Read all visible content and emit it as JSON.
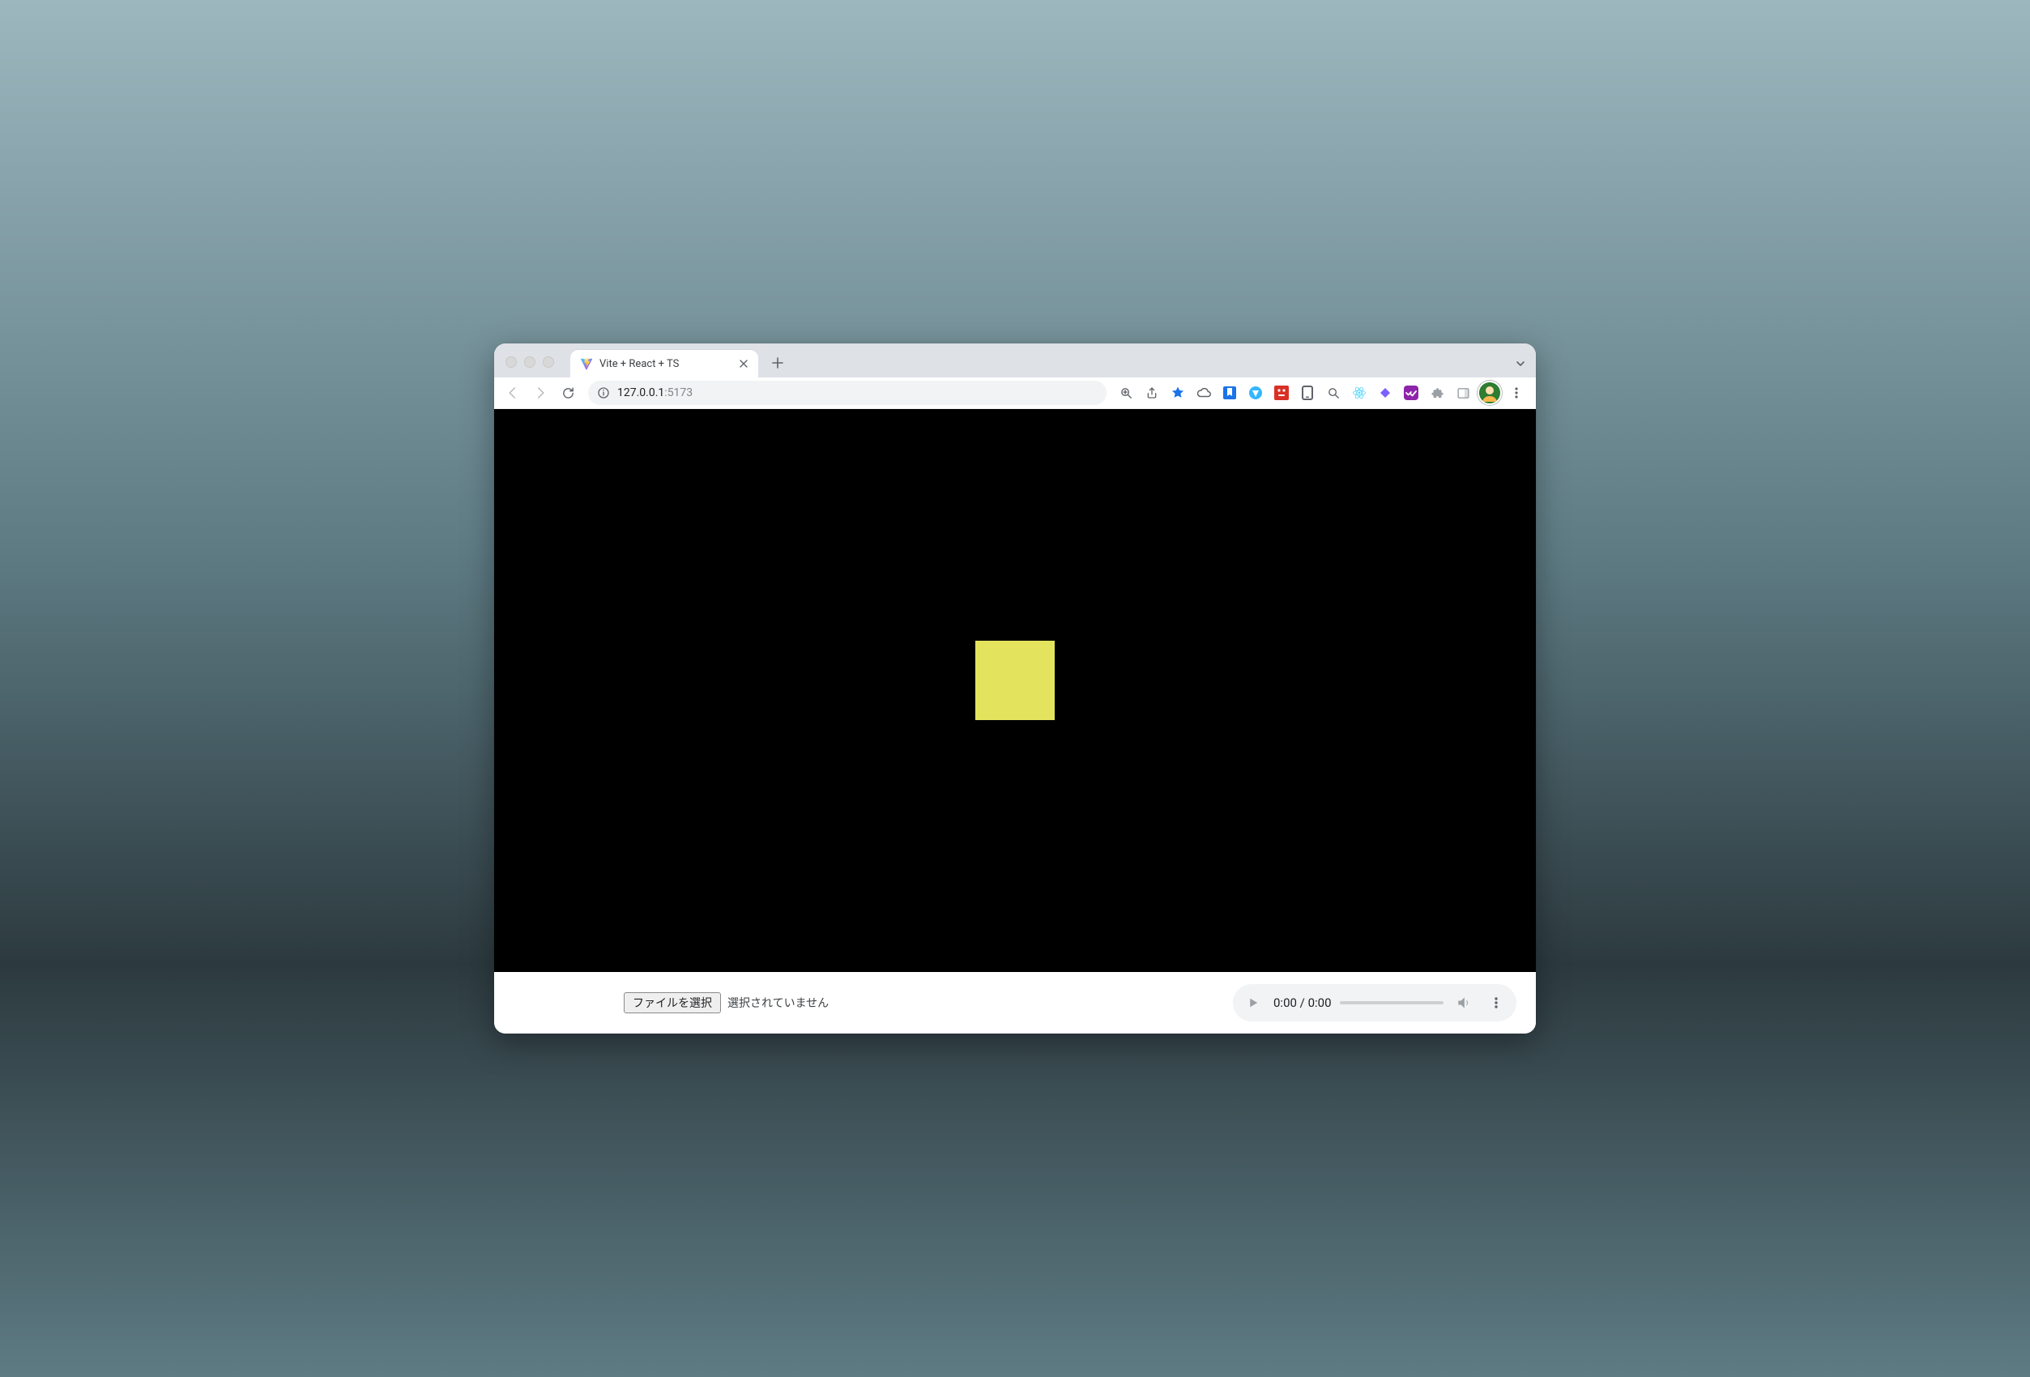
{
  "browser": {
    "tab": {
      "title": "Vite + React + TS"
    },
    "address": {
      "host": "127.0.0.1",
      "port": ":5173"
    }
  },
  "page": {
    "square_color": "#e4e35d",
    "file_input": {
      "button_label": "ファイルを選択",
      "status_text": "選択されていません"
    },
    "audio": {
      "current_time": "0:00",
      "separator": " / ",
      "duration": "0:00"
    }
  }
}
